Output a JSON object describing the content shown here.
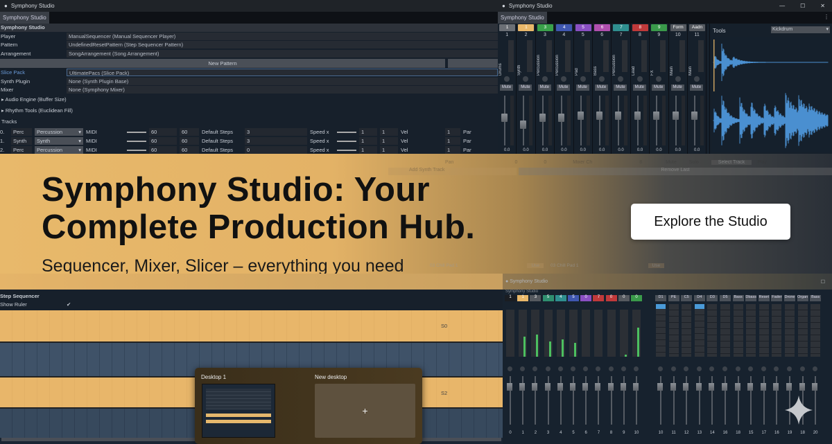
{
  "left_window": {
    "title": "Symphony Studio",
    "tab": "Symphony Studio",
    "header": "Symphony Studio",
    "properties": [
      {
        "label": "Player",
        "value": "ManualSequencer (Manual Sequencer Player)"
      },
      {
        "label": "Pattern",
        "value": "UndefinedResetPattern (Step Sequencer Pattern)"
      },
      {
        "label": "Arrangement",
        "value": "SongArrangement (Song Arrangement)"
      }
    ],
    "new_pattern_button": "New Pattern",
    "properties2": [
      {
        "label": "Slice Pack",
        "value": "UltimatePacs (Slice Pack)"
      },
      {
        "label": "Synth Plugin",
        "value": "None (Synth Plugin Base)"
      },
      {
        "label": "Mixer",
        "value": "None (Symphony Mixer)"
      }
    ],
    "foldouts": [
      "Audio Engine (Buffer Size)",
      "Rhythm Tools (Euclidean Fill)"
    ],
    "tracks_label": "Tracks",
    "tracks": [
      {
        "index": "0.",
        "name": "Perc",
        "type": "Percussion",
        "source": "MIDI",
        "a": "60",
        "b": "60",
        "default_label": "Default Steps",
        "default_value": "3",
        "speed_label": "Speed x",
        "speed_a": "1",
        "speed_b": "1",
        "vel_label": "Vel",
        "vel": "1",
        "pan": "Pan"
      },
      {
        "index": "1.",
        "name": "Synth",
        "type": "Synth",
        "source": "MIDI",
        "a": "60",
        "b": "60",
        "default_label": "Default Steps",
        "default_value": "3",
        "speed_label": "Speed x",
        "speed_a": "1",
        "speed_b": "1",
        "vel_label": "Vel",
        "vel": "1",
        "pan": "Pan"
      },
      {
        "index": "2.",
        "name": "Perc",
        "type": "Percussion",
        "source": "MIDI",
        "a": "60",
        "b": "60",
        "default_label": "Default Steps",
        "default_value": "0",
        "speed_label": "Speed x",
        "speed_a": "1",
        "speed_b": "1",
        "vel_label": "Vel",
        "vel": "1",
        "pan": "Pan"
      }
    ],
    "extra_row": {
      "pan": "Pan",
      "v1": "0",
      "v2": "0",
      "mixer_ch": "Mixer Ch",
      "mixer_val": "8",
      "mute": "Mute",
      "solo": "Solo",
      "select_track": "Select Track",
      "play": "Play"
    },
    "add_synth_track": "Add Synth Track",
    "remove_last": "Remove Last",
    "slots": [
      {
        "label": "03 Chill Pad 1",
        "button": "Use"
      },
      {
        "label": "03 Chill Pad 1",
        "button": "Use"
      }
    ]
  },
  "mixer_window": {
    "title": "Symphony Studio",
    "tab": "Symphony Studio",
    "channels": [
      {
        "chip": "1",
        "num": "1",
        "color": "#6b6f75",
        "name": "Drums",
        "fader": 0.55,
        "readout": "0.0"
      },
      {
        "chip": "1",
        "num": "2",
        "color": "#e9b86a",
        "name": "Synth",
        "fader": 0.42,
        "readout": "0.0"
      },
      {
        "chip": "3",
        "num": "3",
        "color": "#3aa14a",
        "name": "Percussion",
        "fader": 0.55,
        "readout": "0.0"
      },
      {
        "chip": "4",
        "num": "4",
        "color": "#3f57b0",
        "name": "Percussion",
        "fader": 0.56,
        "readout": "0.0"
      },
      {
        "chip": "5",
        "num": "5",
        "color": "#8a4fc2",
        "name": "Pad",
        "fader": 0.6,
        "readout": "0.0"
      },
      {
        "chip": "6",
        "num": "6",
        "color": "#b04fae",
        "name": "Bass",
        "fader": 0.6,
        "readout": "0.0"
      },
      {
        "chip": "7",
        "num": "7",
        "color": "#2f8f8f",
        "name": "Percussion",
        "fader": 0.6,
        "readout": "0.0"
      },
      {
        "chip": "8",
        "num": "8",
        "color": "#c0393a",
        "name": "Lead",
        "fader": 0.6,
        "readout": "0.0"
      },
      {
        "chip": "9",
        "num": "9",
        "color": "#3a9a4a",
        "name": "FX",
        "fader": 0.6,
        "readout": "0.0"
      },
      {
        "chip": "Form",
        "num": "10",
        "color": "#55595f",
        "name": "Main",
        "fader": 0.6,
        "readout": "0.0"
      },
      {
        "chip": "Aadn",
        "num": "11",
        "color": "#55595f",
        "name": "Main",
        "fader": 0.6,
        "readout": "0.0"
      }
    ],
    "mute_label": "Mute",
    "tools_label": "Tools",
    "tools_select": "Kickdrum"
  },
  "banner": {
    "title_line1": "Symphony Studio: Your",
    "title_line2": "Complete Production Hub.",
    "subtitle": "Sequencer, Mixer, Slicer – everything you need",
    "cta": "Explore the Studio"
  },
  "sequencer": {
    "title": "Step Sequencer",
    "show_ruler": "Show Ruler",
    "row_labels": [
      "S0",
      "S2"
    ]
  },
  "task_view": {
    "desktop1": "Desktop 1",
    "new_desktop": "New desktop",
    "add": "+"
  },
  "mixer2": {
    "title": "Symphony Studio",
    "tab": "Symphony Studio",
    "channels": [
      {
        "chip": "1",
        "color": "#1a1d22",
        "level": 0,
        "num": "0"
      },
      {
        "chip": "1",
        "color": "#e9b86a",
        "level": 0.42,
        "num": "1"
      },
      {
        "chip": "3",
        "color": "#55595f",
        "level": 0.47,
        "num": "2"
      },
      {
        "chip": "5",
        "color": "#2f8f6f",
        "level": 0.33,
        "num": "3"
      },
      {
        "chip": "4",
        "color": "#2f8f8f",
        "level": 0.37,
        "num": "4"
      },
      {
        "chip": "5",
        "color": "#3f57b0",
        "level": 0.29,
        "num": "5"
      },
      {
        "chip": "0",
        "color": "#8a4fc2",
        "level": 0,
        "num": "6"
      },
      {
        "chip": "7",
        "color": "#c0393a",
        "level": 0,
        "num": "7"
      },
      {
        "chip": "0",
        "color": "#c0393a",
        "level": 0,
        "num": "8"
      },
      {
        "chip": "0",
        "color": "#55595f",
        "level": 0.04,
        "num": "9"
      },
      {
        "chip": "0",
        "color": "#3a9a4a",
        "level": 0.62,
        "num": "10"
      }
    ],
    "buses": [
      "D1",
      "PE",
      "C5",
      "D4",
      "D3",
      "D5",
      "Bass",
      "Dbass",
      "Reset",
      "Fader",
      "Drone",
      "Organ",
      "Bass"
    ],
    "bus_nums": [
      "10",
      "11",
      "12",
      "13",
      "14",
      "16",
      "18",
      "15",
      "17",
      "16",
      "19",
      "18",
      "20"
    ]
  }
}
